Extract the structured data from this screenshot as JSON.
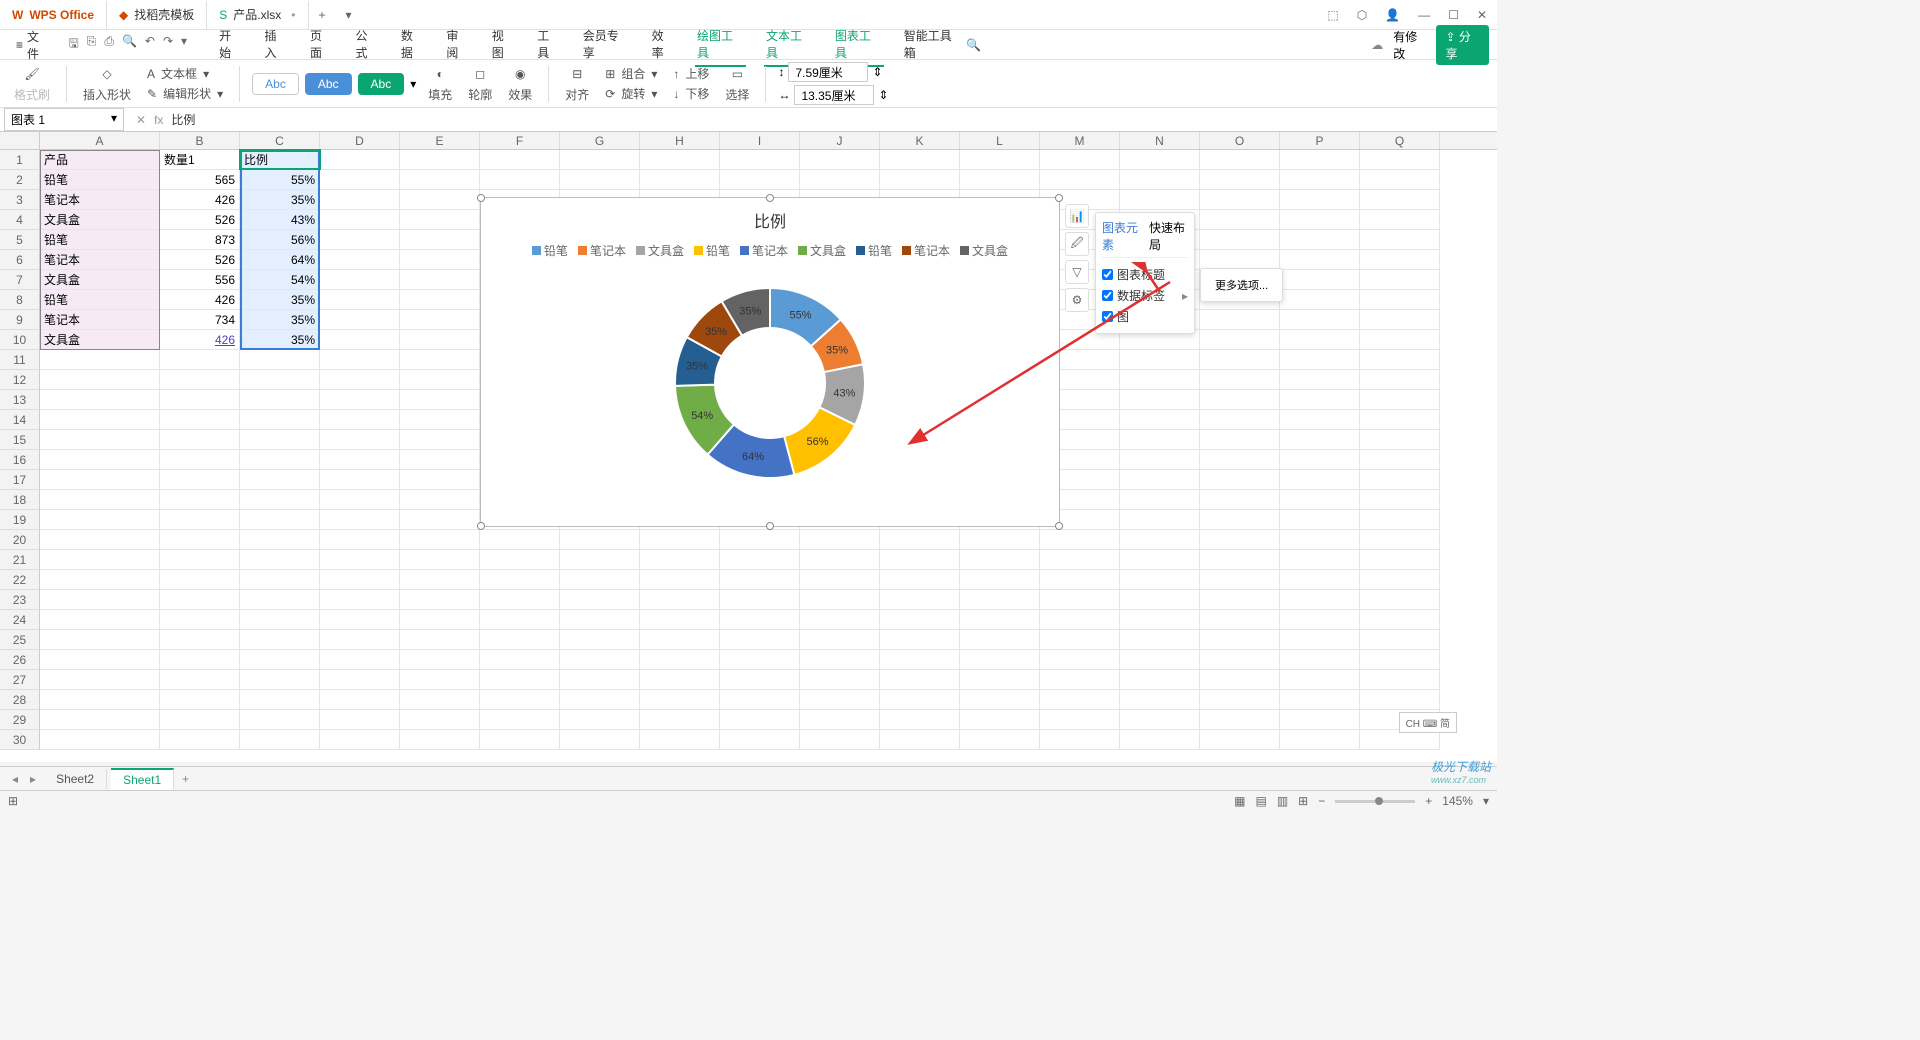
{
  "title_bar": {
    "app_name": "WPS Office",
    "tab2": "找稻壳模板",
    "tab3": "产品.xlsx",
    "win": {
      "cube": "⬚",
      "user": "👤",
      "min": "—",
      "max": "☐",
      "close": "✕"
    }
  },
  "menu": {
    "file": "文件",
    "items": [
      "开始",
      "插入",
      "页面",
      "公式",
      "数据",
      "审阅",
      "视图",
      "工具",
      "会员专享",
      "效率",
      "绘图工具",
      "文本工具",
      "图表工具",
      "智能工具箱"
    ],
    "active_idx": 10,
    "modify": "有修改",
    "share": "分享"
  },
  "ribbon": {
    "format_painter": "格式刷",
    "insert_shape": "插入形状",
    "text_box": "文本框",
    "edit_shape": "编辑形状",
    "abc": "Abc",
    "fill": "填充",
    "outline": "轮廓",
    "effect": "效果",
    "align": "对齐",
    "group": "组合",
    "rotate": "旋转",
    "up": "上移",
    "down": "下移",
    "select": "选择",
    "height": "7.59厘米",
    "width": "13.35厘米"
  },
  "formula_bar": {
    "name": "图表 1",
    "fx": "fx",
    "value": "比例"
  },
  "columns": [
    "A",
    "B",
    "C",
    "D",
    "E",
    "F",
    "G",
    "H",
    "I",
    "J",
    "K",
    "L",
    "M",
    "N",
    "O",
    "P",
    "Q"
  ],
  "data": {
    "headers": {
      "A": "产品",
      "B": "数量1",
      "C": "比例"
    },
    "rows": [
      {
        "A": "铅笔",
        "B": "565",
        "C": "55%"
      },
      {
        "A": "笔记本",
        "B": "426",
        "C": "35%"
      },
      {
        "A": "文具盒",
        "B": "526",
        "C": "43%"
      },
      {
        "A": "铅笔",
        "B": "873",
        "C": "56%"
      },
      {
        "A": "笔记本",
        "B": "526",
        "C": "64%"
      },
      {
        "A": "文具盒",
        "B": "556",
        "C": "54%"
      },
      {
        "A": "铅笔",
        "B": "426",
        "C": "35%"
      },
      {
        "A": "笔记本",
        "B": "734",
        "C": "35%"
      },
      {
        "A": "文具盒",
        "B": "426",
        "C": "35%"
      }
    ]
  },
  "chart_data": {
    "type": "pie",
    "title": "比例",
    "categories": [
      "铅笔",
      "笔记本",
      "文具盒",
      "铅笔",
      "笔记本",
      "文具盒",
      "铅笔",
      "笔记本",
      "文具盒"
    ],
    "values": [
      55,
      35,
      43,
      56,
      64,
      54,
      35,
      35,
      35
    ],
    "labels": [
      "55%",
      "35%",
      "43%",
      "56%",
      "64%",
      "54%",
      "35%",
      "35%",
      "35%"
    ],
    "colors": [
      "#5b9bd5",
      "#ed7d31",
      "#a5a5a5",
      "#ffc000",
      "#4472c4",
      "#70ad47",
      "#255e91",
      "#9e480e",
      "#636363"
    ]
  },
  "side_popup": {
    "tab1": "图表元素",
    "tab2": "快速布局",
    "opts": [
      "图表标题",
      "数据标签",
      "图"
    ],
    "more": "更多选项..."
  },
  "sheets": {
    "s1": "Sheet2",
    "s2": "Sheet1"
  },
  "status": {
    "ime": "CH ⌨ 简",
    "zoom": "145%",
    "views": [
      "▦",
      "▤",
      "▥",
      "⊞"
    ]
  },
  "watermark": {
    "l1": "极光下载站",
    "l2": "www.xz7.com"
  }
}
